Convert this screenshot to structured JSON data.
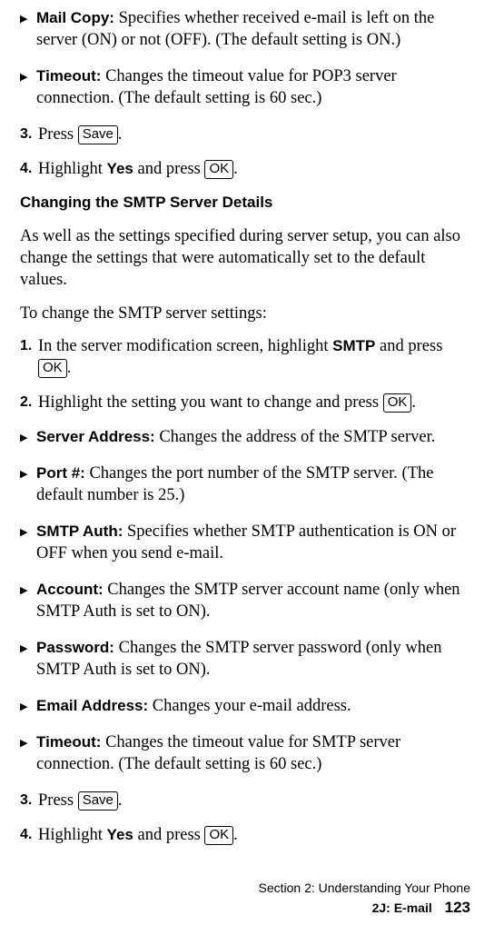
{
  "items": [
    {
      "kind": "bullet",
      "term": "Mail Copy:",
      "rest": " Specifies whether received e-mail is left on the server (ON) or not (OFF). (The default setting is ON.)"
    },
    {
      "kind": "bullet",
      "term": "Timeout:",
      "rest": " Changes the timeout value for POP3 server connection. (The default setting is 60 sec.)"
    },
    {
      "kind": "num",
      "num": "3.",
      "pre": "Press ",
      "key": "Save",
      "post": "."
    },
    {
      "kind": "num",
      "num": "4.",
      "pre": "Highlight ",
      "strong": "Yes",
      "mid": " and press ",
      "key": "OK",
      "post": "."
    },
    {
      "kind": "heading",
      "text": "Changing the SMTP Server Details"
    },
    {
      "kind": "para",
      "text": "As well as the settings specified during server setup, you can also change the settings that were automatically set to the default values."
    },
    {
      "kind": "para",
      "text": "To change the SMTP server settings:"
    },
    {
      "kind": "num",
      "num": "1.",
      "pre": "In the server modification screen, highlight ",
      "strong": "SMTP",
      "mid": " and press ",
      "key": "OK",
      "post": "."
    },
    {
      "kind": "num",
      "num": "2.",
      "pre": "Highlight the setting you want to change and press ",
      "key": "OK",
      "post": "."
    },
    {
      "kind": "bullet",
      "term": "Server Address:",
      "rest": " Changes the address of the SMTP server."
    },
    {
      "kind": "bullet",
      "term": "Port #:",
      "rest": " Changes the port number of the SMTP server. (The default number is 25.)"
    },
    {
      "kind": "bullet",
      "term": "SMTP Auth:",
      "rest": " Specifies whether SMTP authentication is ON or OFF when you send e-mail."
    },
    {
      "kind": "bullet",
      "term": "Account:",
      "rest": " Changes the SMTP server account name (only when SMTP Auth is set to ON)."
    },
    {
      "kind": "bullet",
      "term": "Password:",
      "rest": " Changes the SMTP server password (only when SMTP Auth is set to ON)."
    },
    {
      "kind": "bullet",
      "term": "Email Address:",
      "rest": " Changes your e-mail address."
    },
    {
      "kind": "bullet",
      "term": "Timeout:",
      "rest": " Changes the timeout value for SMTP server connection. (The default setting is 60 sec.)"
    },
    {
      "kind": "num",
      "num": "3.",
      "pre": "Press ",
      "key": "Save",
      "post": "."
    },
    {
      "kind": "num",
      "num": "4.",
      "pre": "Highlight ",
      "strong": "Yes",
      "mid": " and press ",
      "key": "OK",
      "post": "."
    }
  ],
  "footer": {
    "line1": "Section 2: Understanding Your Phone",
    "line2_label": "2J: E-mail",
    "page": "123"
  }
}
